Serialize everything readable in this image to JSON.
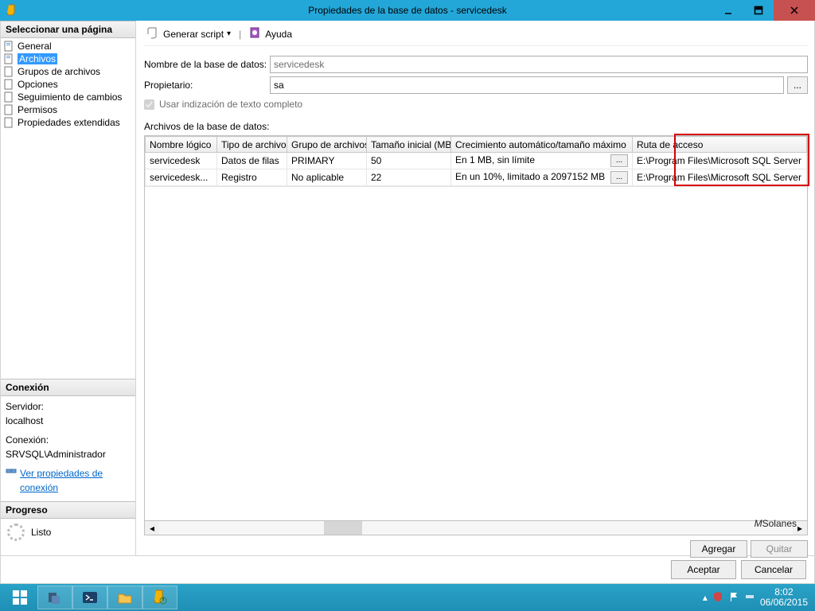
{
  "titlebar": {
    "title": "Propiedades de la base de datos - servicedesk"
  },
  "left": {
    "select_page": "Seleccionar una página",
    "items": [
      {
        "label": "General"
      },
      {
        "label": "Archivos"
      },
      {
        "label": "Grupos de archivos"
      },
      {
        "label": "Opciones"
      },
      {
        "label": "Seguimiento de cambios"
      },
      {
        "label": "Permisos"
      },
      {
        "label": "Propiedades extendidas"
      }
    ],
    "connection_hdr": "Conexión",
    "server_lbl": "Servidor:",
    "server_val": "localhost",
    "conn_lbl": "Conexión:",
    "conn_val": "SRVSQL\\Administrador",
    "view_conn": "Ver propiedades de conexión",
    "progress_hdr": "Progreso",
    "progress_state": "Listo"
  },
  "toolbar": {
    "script": "Generar script",
    "help": "Ayuda"
  },
  "form": {
    "dbname_lbl": "Nombre de la base de datos:",
    "dbname_val": "servicedesk",
    "owner_lbl": "Propietario:",
    "owner_val": "sa",
    "fulltext_lbl": "Usar indización de texto completo"
  },
  "grid": {
    "title": "Archivos de la base de datos:",
    "headers": [
      "Nombre lógico",
      "Tipo de archivo",
      "Grupo de archivos",
      "Tamaño inicial (MB)",
      "Crecimiento automático/tamaño máximo",
      "Ruta de acceso"
    ],
    "rows": [
      {
        "name": "servicedesk",
        "type": "Datos de filas",
        "group": "PRIMARY",
        "size": "50",
        "growth": "En 1 MB, sin límite",
        "path": "E:\\Program Files\\Microsoft SQL Server"
      },
      {
        "name": "servicedesk...",
        "type": "Registro",
        "group": "No aplicable",
        "size": "22",
        "growth": "En un 10%, limitado a 2097152 MB",
        "path": "E:\\Program Files\\Microsoft SQL Server"
      }
    ],
    "add": "Agregar",
    "remove": "Quitar"
  },
  "footer": {
    "ok": "Aceptar",
    "cancel": "Cancelar"
  },
  "taskbar": {
    "time": "8:02",
    "date": "06/06/2015"
  },
  "watermark": "Solanes"
}
